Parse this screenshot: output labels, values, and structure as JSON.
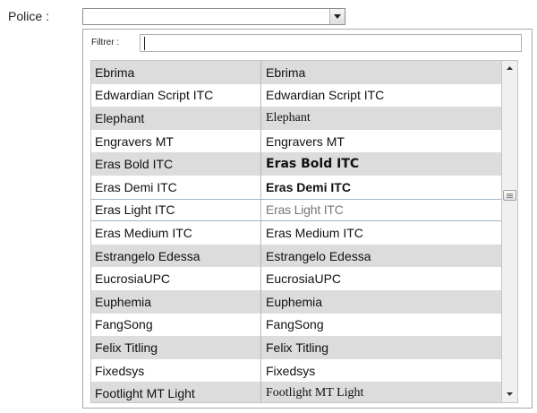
{
  "police": {
    "label": "Police :",
    "value": ""
  },
  "filter": {
    "label": "Filtrer :",
    "value": ""
  },
  "fonts": [
    {
      "name": "Ebrima",
      "preview": "Ebrima",
      "style": ""
    },
    {
      "name": "Edwardian Script ITC",
      "preview": "Edwardian Script ITC",
      "style": ""
    },
    {
      "name": "Elephant",
      "preview": "Elephant",
      "style": "serif"
    },
    {
      "name": "Engravers MT",
      "preview": "Engravers MT",
      "style": ""
    },
    {
      "name": "Eras Bold ITC",
      "preview": "Eras Bold ITC",
      "style": "bold"
    },
    {
      "name": "Eras Demi ITC",
      "preview": "Eras Demi ITC",
      "style": "semibold"
    },
    {
      "name": "Eras Light ITC",
      "preview": "Eras Light ITC",
      "style": "light"
    },
    {
      "name": "Eras Medium ITC",
      "preview": "Eras Medium ITC",
      "style": ""
    },
    {
      "name": "Estrangelo Edessa",
      "preview": "Estrangelo Edessa",
      "style": ""
    },
    {
      "name": "EucrosiaUPC",
      "preview": "EucrosiaUPC",
      "style": ""
    },
    {
      "name": "Euphemia",
      "preview": "Euphemia",
      "style": ""
    },
    {
      "name": "FangSong",
      "preview": "FangSong",
      "style": ""
    },
    {
      "name": "Felix Titling",
      "preview": "Felix Titling",
      "style": ""
    },
    {
      "name": "Fixedsys",
      "preview": "Fixedsys",
      "style": ""
    },
    {
      "name": "Footlight MT Light",
      "preview": "Footlight MT Light",
      "style": "serif"
    }
  ],
  "selected_index": 6,
  "icons": {
    "combo": "chevron-down-icon",
    "scroll_up": "arrow-up-icon",
    "scroll_down": "arrow-down-icon",
    "thumb": "scroll-grip-icon"
  },
  "colors": {
    "alt_row": "#dcdcdc",
    "selected_border": "#9db4cf",
    "panel_border": "#a9a9a9"
  }
}
